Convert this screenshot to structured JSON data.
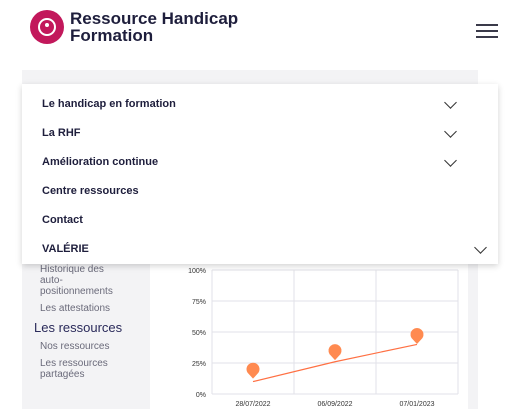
{
  "header": {
    "brand_line1": "Ressource Handicap",
    "brand_line2": "Formation"
  },
  "menu": {
    "items": [
      {
        "label": "Le handicap en formation"
      },
      {
        "label": "La RHF"
      },
      {
        "label": "Amélioration continue"
      },
      {
        "label": "Centre ressources"
      },
      {
        "label": "Contact"
      },
      {
        "label": "VALÉRIE"
      }
    ]
  },
  "sidebar": {
    "history": "Historique des auto-positionnements",
    "attestations": "Les attestations",
    "resources_title": "Les ressources",
    "our_resources": "Nos ressources",
    "shared_resources": "Les ressources partagées"
  },
  "colors": {
    "accent": "#c2185b",
    "chart_line": "#ff7043",
    "chart_marker": "#ff8a50"
  },
  "chart_data": {
    "type": "line",
    "categories": [
      "28/07/2022",
      "06/09/2022",
      "07/01/2023"
    ],
    "values": [
      18,
      33,
      46
    ],
    "series": [
      {
        "values": [
          18,
          33,
          46
        ]
      }
    ],
    "trendline": [
      10,
      26,
      40
    ],
    "yticks": [
      "0%",
      "25%",
      "50%",
      "75%",
      "100%"
    ],
    "ylim": [
      0,
      100
    ],
    "grid": true
  }
}
